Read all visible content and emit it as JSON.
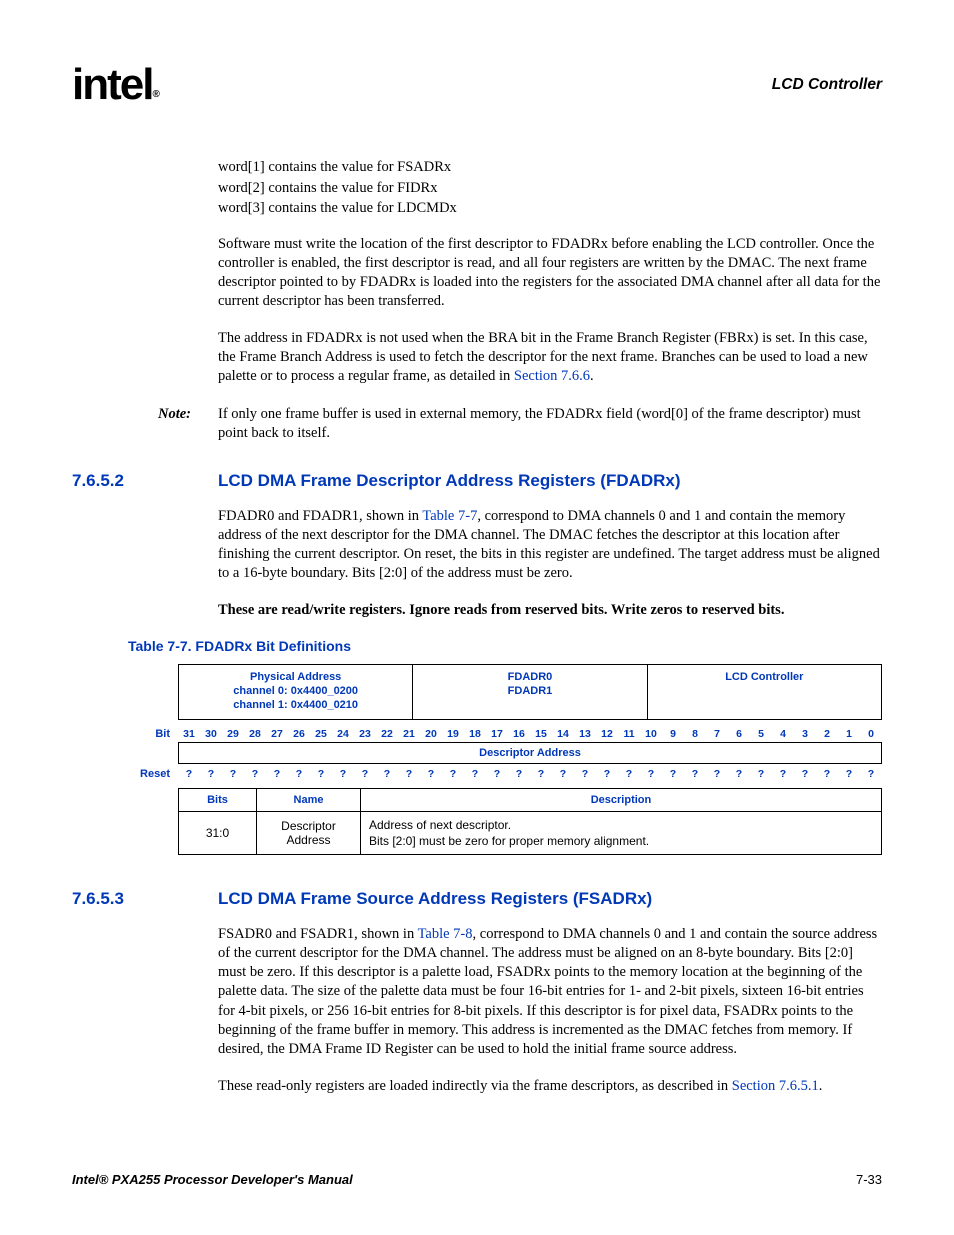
{
  "header": {
    "logo_text": "intel",
    "logo_reg": "®",
    "chapter": "LCD Controller"
  },
  "intro_lines": {
    "l1": "word[1] contains the value for FSADRx",
    "l2": "word[2] contains the value for FIDRx",
    "l3": "word[3] contains the value for LDCMDx"
  },
  "para1": "Software must write the location of the first descriptor to FDADRx before enabling the LCD controller. Once the controller is enabled, the first descriptor is read, and all four registers are written by the DMAC. The next frame descriptor pointed to by FDADRx is loaded into the registers for the associated DMA channel after all data for the current descriptor has been transferred.",
  "para2_a": "The address in FDADRx is not used when the BRA bit in the Frame Branch Register (FBRx) is set. In this case, the Frame Branch Address is used to fetch the descriptor for the next frame. Branches can be used to load a new palette or to process a regular frame, as detailed in ",
  "para2_link": "Section 7.6.6",
  "para2_b": ".",
  "note": {
    "label": "Note:",
    "text": "If only one frame buffer is used in external memory, the FDADRx field (word[0] of the frame descriptor) must point back to itself."
  },
  "sec7652": {
    "num": "7.6.5.2",
    "title": "LCD DMA Frame Descriptor Address Registers (FDADRx)",
    "p1_a": "FDADR0 and FDADR1, shown in ",
    "p1_link": "Table 7-7",
    "p1_b": ", correspond to DMA channels 0 and 1 and contain the memory address of the next descriptor for the DMA channel. The DMAC fetches the descriptor at this location after finishing the current descriptor. On reset, the bits in this register are undefined. The target address must be aligned to a 16-byte boundary. Bits [2:0] of the address must be zero.",
    "p2_bold": "These are read/write registers. Ignore reads from reserved bits. Write zeros to reserved bits."
  },
  "table77": {
    "caption": "Table 7-7. FDADRx Bit Definitions",
    "phys_label": "Physical Address",
    "phys_ch0": "channel 0: 0x4400_0200",
    "phys_ch1": "channel 1: 0x4400_0210",
    "regname0": "FDADR0",
    "regname1": "FDADR1",
    "block": "LCD Controller",
    "bit_label": "Bit",
    "reset_label": "Reset",
    "field_band": "Descriptor Address",
    "bits": [
      "31",
      "30",
      "29",
      "28",
      "27",
      "26",
      "25",
      "24",
      "23",
      "22",
      "21",
      "20",
      "19",
      "18",
      "17",
      "16",
      "15",
      "14",
      "13",
      "12",
      "11",
      "10",
      "9",
      "8",
      "7",
      "6",
      "5",
      "4",
      "3",
      "2",
      "1",
      "0"
    ],
    "resets": [
      "?",
      "?",
      "?",
      "?",
      "?",
      "?",
      "?",
      "?",
      "?",
      "?",
      "?",
      "?",
      "?",
      "?",
      "?",
      "?",
      "?",
      "?",
      "?",
      "?",
      "?",
      "?",
      "?",
      "?",
      "?",
      "?",
      "?",
      "?",
      "?",
      "?",
      "?",
      "?"
    ],
    "cols": {
      "bits": "Bits",
      "name": "Name",
      "desc": "Description"
    },
    "row": {
      "bits": "31:0",
      "name": "Descriptor Address",
      "desc1": "Address of next descriptor.",
      "desc2": "Bits [2:0] must be zero for proper memory alignment."
    }
  },
  "sec7653": {
    "num": "7.6.5.3",
    "title": "LCD DMA Frame Source Address Registers (FSADRx)",
    "p1_a": "FSADR0 and FSADR1, shown in ",
    "p1_link": "Table 7-8",
    "p1_b": ", correspond to DMA channels 0 and 1 and contain the source address of the current descriptor for the DMA channel. The address must be aligned on an 8-byte boundary. Bits [2:0] must be zero. If this descriptor is a palette load, FSADRx points to the memory location at the beginning of the palette data. The size of the palette data must be four 16-bit entries for 1- and 2-bit pixels, sixteen 16-bit entries for 4-bit pixels, or 256 16-bit entries for 8-bit pixels. If this descriptor is for pixel data, FSADRx points to the beginning of the frame buffer in memory. This address is incremented as the DMAC fetches from memory. If desired, the DMA Frame ID Register can be used to hold the initial frame source address.",
    "p2_a": "These read-only registers are loaded indirectly via the frame descriptors, as described in ",
    "p2_link": "Section 7.6.5.1",
    "p2_b": "."
  },
  "footer": {
    "manual": "Intel® PXA255 Processor Developer's Manual",
    "page": "7-33"
  }
}
